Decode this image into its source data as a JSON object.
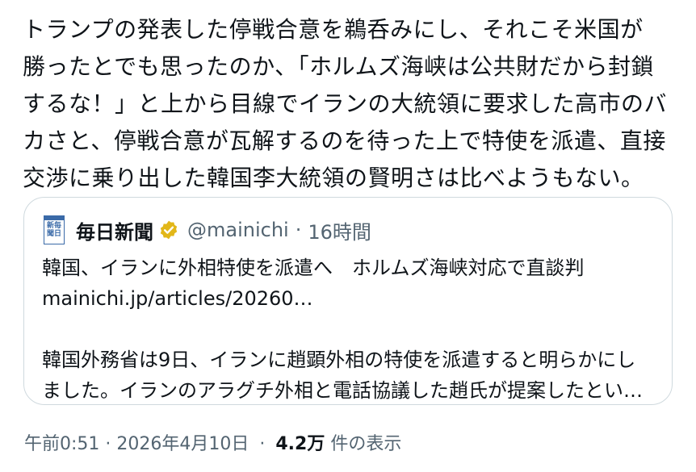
{
  "tweet": {
    "text": "トランプの発表した停戦合意を鵜呑みにし、それこそ米国が\n勝ったとでも思ったのか、「ホルムズ海峡は公共財だから封鎖\nするな！」と上から目線でイランの大統領に要求した高市のバ\nカさと、停戦合意が瓦解するのを待った上で特使を派遣、直接\n交渉に乗り出した韓国李大統領の賢明さは比べようもない。"
  },
  "quote": {
    "avatar_glyph": "新毎\n聞日",
    "display_name": "毎日新聞",
    "handle": "@mainichi",
    "separator": "·",
    "time": "16時間",
    "headline": "韓国、イランに外相特使を派遣へ　ホルムズ海峡対応で直談判",
    "link": "mainichi.jp/articles/20260…",
    "summary_line1": "韓国外務省は9日、イランに趙顕外相の特使を派遣すると明らかにし",
    "summary_line2": "ました。イランのアラグチ外相と電話協議した趙氏が提案したとい…",
    "verified_color": "#e2b719"
  },
  "meta": {
    "timestamp": "午前0:51 · 2026年4月10日",
    "separator": "·",
    "views_count": "4.2万",
    "views_label": "件の表示"
  }
}
